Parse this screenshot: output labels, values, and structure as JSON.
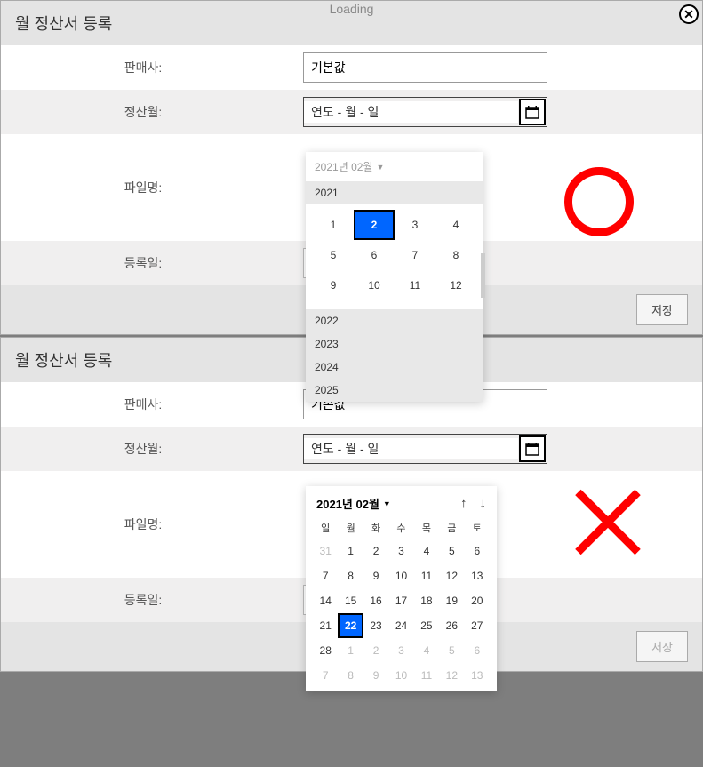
{
  "loading_text": "Loading",
  "dialog_title": "월 정산서 등록",
  "labels": {
    "seller": "판매사:",
    "month": "정산월:",
    "filename": "파일명:",
    "regdate": "등록일:"
  },
  "values": {
    "seller": "기본값",
    "date_placeholder": "연도 - 월 - 일"
  },
  "buttons": {
    "save": "저장"
  },
  "month_picker": {
    "header": "2021년 02월",
    "expanded_year": "2021",
    "selected_month": 2,
    "months": [
      "1",
      "2",
      "3",
      "4",
      "5",
      "6",
      "7",
      "8",
      "9",
      "10",
      "11",
      "12"
    ],
    "other_years": [
      "2022",
      "2023",
      "2024",
      "2025"
    ]
  },
  "date_picker": {
    "header": "2021년 02월",
    "dow": [
      "일",
      "월",
      "화",
      "수",
      "목",
      "금",
      "토"
    ],
    "selected_day": 22,
    "prev_trail": [
      31
    ],
    "days": [
      1,
      2,
      3,
      4,
      5,
      6,
      7,
      8,
      9,
      10,
      11,
      12,
      13,
      14,
      15,
      16,
      17,
      18,
      19,
      20,
      21,
      22,
      23,
      24,
      25,
      26,
      27,
      28
    ],
    "next_trail": [
      1,
      2,
      3,
      4,
      5,
      6,
      7,
      8,
      9,
      10,
      11,
      12,
      13
    ]
  }
}
